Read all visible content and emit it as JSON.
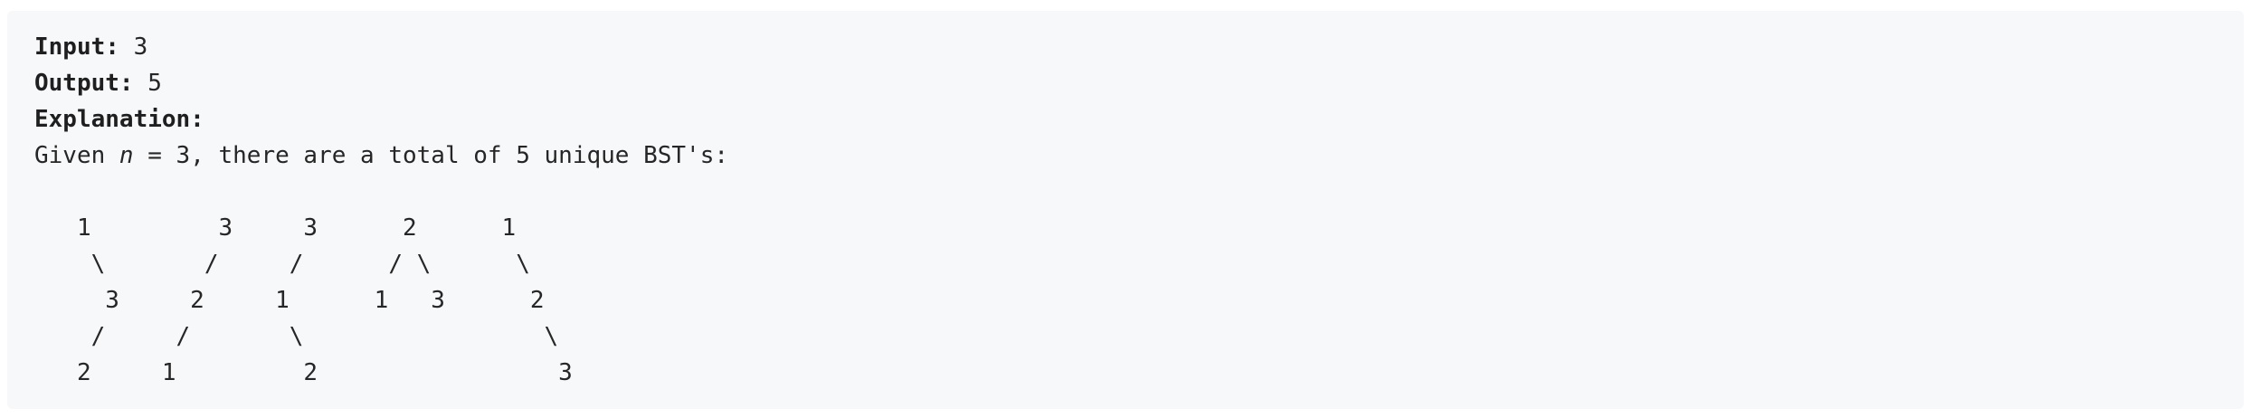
{
  "example": {
    "input_label": "Input:",
    "input_value": " 3",
    "output_label": "Output:",
    "output_value": " 5",
    "explanation_label": "Explanation:",
    "explanation": {
      "prefix": "Given ",
      "var": "n",
      "suffix": " = 3, there are a total of 5 unique BST's:"
    },
    "tree_lines": [
      "   1         3     3      2      1",
      "    \\       /     /      / \\      \\",
      "     3     2     1      1   3      2",
      "    /     /       \\                 \\",
      "   2     1         2                 3"
    ]
  }
}
